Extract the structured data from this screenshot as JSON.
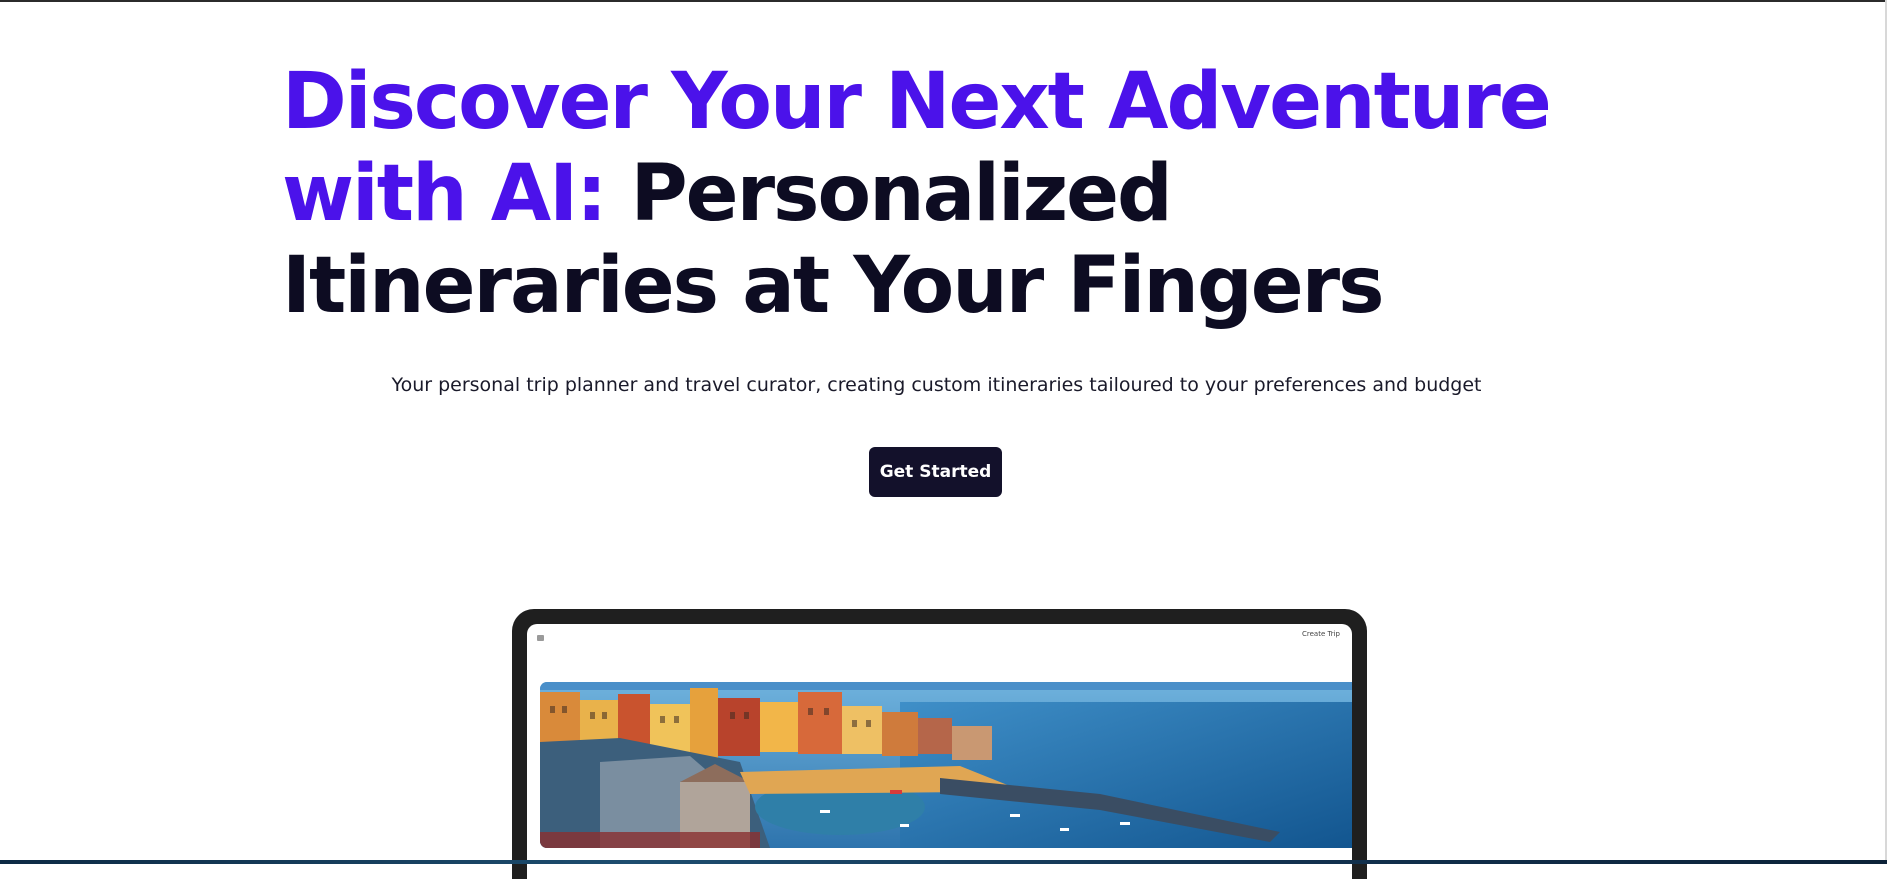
{
  "hero": {
    "heading_accent": "Discover Your Next Adventure with AI:",
    "heading_rest": "Personalized Itineraries at Your Fingers",
    "subtitle": "Your personal trip planner and travel curator, creating custom itineraries tailoured to your preferences and budget",
    "cta_label": "Get Started"
  },
  "device_preview": {
    "nav_link": "Create Trip",
    "banner_image": "coastal-village-photo"
  },
  "colors": {
    "accent": "#4b12ea",
    "heading": "#0d0c22",
    "button_bg": "#13112b",
    "button_text": "#ffffff",
    "background": "#ffffff"
  }
}
